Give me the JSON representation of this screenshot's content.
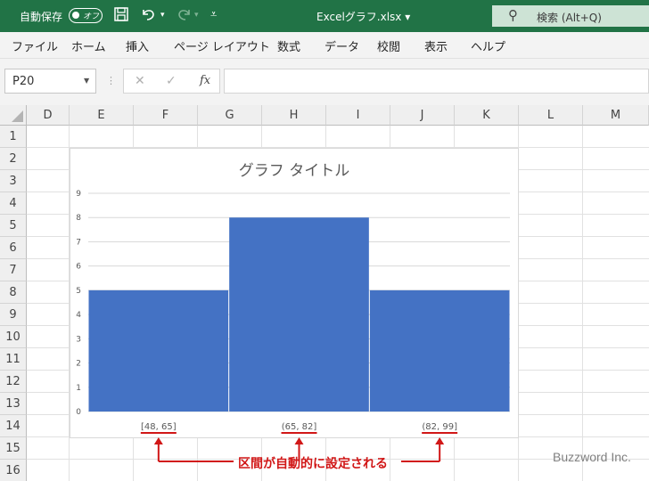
{
  "titlebar": {
    "autosave_label": "自動保存",
    "autosave_state": "オフ",
    "filename": "Excelグラフ.xlsx ▾",
    "search_text": "検索 (Alt+Q)"
  },
  "ribbon": {
    "tabs": [
      "ファイル",
      "ホーム",
      "挿入",
      "ページ レイアウト",
      "数式",
      "データ",
      "校閲",
      "表示",
      "ヘルプ"
    ]
  },
  "formula_bar": {
    "name_box": "P20",
    "formula": ""
  },
  "grid": {
    "columns": [
      "D",
      "E",
      "F",
      "G",
      "H",
      "I",
      "J",
      "K",
      "L",
      "M"
    ],
    "rows": [
      "1",
      "2",
      "3",
      "4",
      "5",
      "6",
      "7",
      "8",
      "9",
      "10",
      "11",
      "12",
      "13",
      "14",
      "15",
      "16"
    ]
  },
  "chart_data": {
    "type": "bar",
    "title": "グラフ タイトル",
    "categories": [
      "[48, 65]",
      "(65, 82]",
      "(82, 99]"
    ],
    "values": [
      5,
      8,
      5
    ],
    "ylim": [
      0,
      9
    ],
    "yticks": [
      0,
      1,
      2,
      3,
      4,
      5,
      6,
      7,
      8,
      9
    ],
    "grid": true,
    "bar_color": "#4472c4"
  },
  "annotation": {
    "text": "区間が自動的に設定される",
    "color": "#d11717"
  },
  "watermark": "Buzzword Inc."
}
